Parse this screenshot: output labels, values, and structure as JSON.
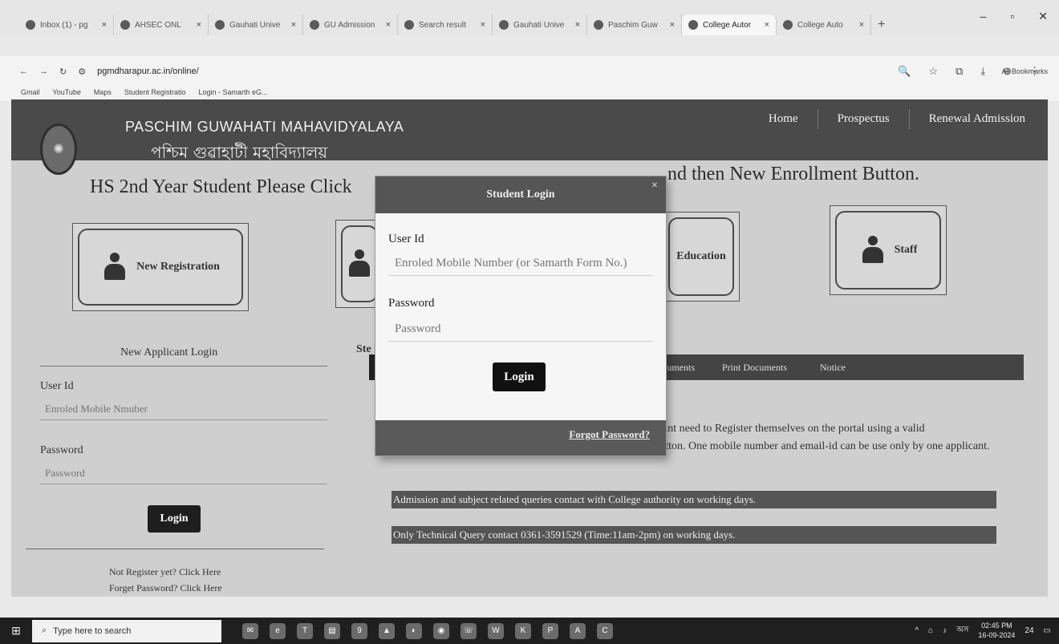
{
  "browser": {
    "tabs": [
      {
        "title": "Inbox (1) - pg",
        "icon": "gmail-icon",
        "active": false
      },
      {
        "title": "AHSEC ONL",
        "icon": "globe-icon",
        "active": false
      },
      {
        "title": "Gauhati Unive",
        "icon": "globe-icon",
        "active": false
      },
      {
        "title": "GU Admission",
        "icon": "doc-icon",
        "active": false
      },
      {
        "title": "Search result",
        "icon": "search-icon",
        "active": false
      },
      {
        "title": "Gauhati Unive",
        "icon": "globe-icon",
        "active": false
      },
      {
        "title": "Paschim Guw",
        "icon": "globe-icon",
        "active": false
      },
      {
        "title": "College Autor",
        "icon": "globe-icon",
        "active": true
      },
      {
        "title": "College Auto",
        "icon": "globe-icon",
        "active": false
      }
    ],
    "url": "pgmdharapur.ac.in/online/",
    "bookmarks": [
      "Gmail",
      "YouTube",
      "Maps",
      "Student Registratio",
      "Login - Samarth eG..."
    ],
    "all_bookmarks": "All Bookmarks"
  },
  "site": {
    "college_name_en": "PASCHIM GUWAHATI MAHAVIDYALAYA",
    "college_name_bn": "পশ্চিম গুৱাহাটী মহাবিদ্যালয়",
    "nav": [
      "Home",
      "Prospectus",
      "Renewal Admission"
    ],
    "banner_left": "HS 2nd Year Student Please Click",
    "banner_right": "nd then New Enrollment Button.",
    "cards": {
      "new_registration": "New Registration",
      "education": "Education",
      "staff": "Staff"
    },
    "applicant_login": {
      "title": "New Applicant Login",
      "user_id_label": "User Id",
      "user_id_placeholder": "Enroled Mobile Nmuber",
      "password_label": "Password",
      "password_placeholder": "Password",
      "login_button": "Login",
      "not_registered": "Not Register yet? Click Here",
      "forgot": "Forget Password? Click Here"
    },
    "steps_label": "Ste",
    "tabs": [
      "cuments",
      "Print Documents",
      "Notice"
    ],
    "intro_first": "ant need to Register themselves on the portal using a valid",
    "intro_rest": "Email, Phone Number by clicking on \"New Registration\" button. One mobile number and email-id can be use only by one applicant.",
    "notice_1": "Admission and subject related queries contact with College authority on working days.",
    "notice_2": "Only Technical Query contact 0361-3591529 (Time:11am-2pm) on working days."
  },
  "modal": {
    "title": "Student Login",
    "close": "×",
    "user_id_label": "User Id",
    "user_id_placeholder": "Enroled Mobile Number (or Samarth Form No.)",
    "password_label": "Password",
    "password_placeholder": "Password",
    "login_button": "Login",
    "forgot": "Forgot Password?"
  },
  "taskbar": {
    "search_placeholder": "Type here to search",
    "clock_time": "02:45 PM",
    "clock_date": "16-09-2024",
    "lang": "অস",
    "notif_count": "24"
  }
}
